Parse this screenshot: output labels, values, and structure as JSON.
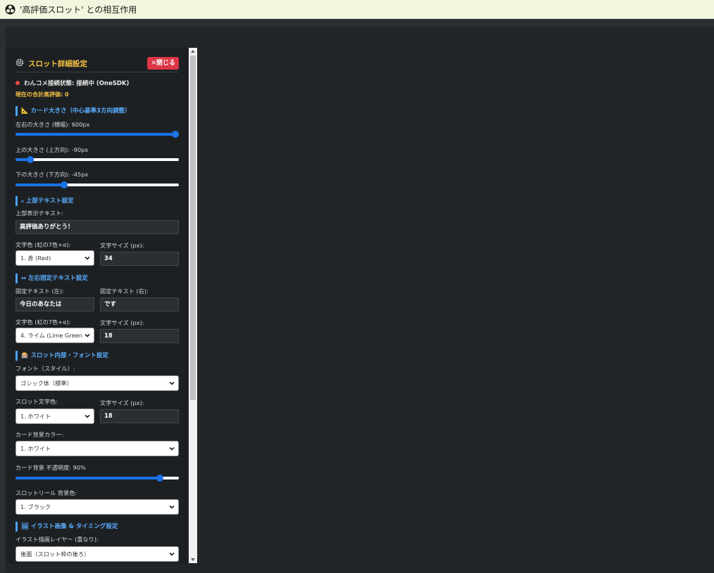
{
  "window": {
    "title": "'高評価スロット' との相互作用"
  },
  "panel": {
    "title": "スロット詳細設定",
    "close_label": "✕閉じる",
    "status_text": "わんコメ接続状態: 接続中 (OneSDK)",
    "total_text": "現在の合計高評価: 0",
    "card_size": {
      "heading": "📐 カード大きさ（中心基準3方向調整）",
      "width_label": "左右の大きさ (横幅): 600px",
      "width_level": 1.0,
      "top_label": "上の大きさ (上方向): -90px",
      "top_level": 0.07,
      "bottom_label": "下の大きさ (下方向): -45px",
      "bottom_level": 0.29
    },
    "top_text": {
      "heading": "ℴ 上部テキスト設定",
      "text_label": "上部表示テキスト:",
      "text_value": "高評価ありがとう！",
      "color_label": "文字色 (虹の7色+α):",
      "color_value": "1. 赤 (Red)",
      "size_label": "文字サイズ (px):",
      "size_value": "34"
    },
    "side_text": {
      "heading": "↔ 左右固定テキスト設定",
      "left_label": "固定テキスト (左):",
      "left_value": "今日のあなたは",
      "right_label": "固定テキスト (右):",
      "right_value": "です",
      "color_label": "文字色 (虹の7色+α):",
      "color_value": "4. ライム (Lime Green",
      "size_label": "文字サイズ (px):",
      "size_value": "18"
    },
    "slot_font": {
      "heading": "🎰 スロット内部・フォント設定",
      "font_label": "フォント（スタイル）:",
      "font_value": "ゴシック体（標準）",
      "slot_color_label": "スロット文字色:",
      "slot_color_value": "1. ホワイト",
      "size_label": "文字サイズ (px):",
      "size_value": "18",
      "bg_color_label": "カード背景カラー:",
      "bg_color_value": "1. ホワイト",
      "opacity_label": "カード背景 不透明度: 90%",
      "opacity_level": 0.9,
      "reel_bg_label": "スロットリール 背景色:",
      "reel_bg_value": "1. ブラック"
    },
    "illustration": {
      "heading": "🖼 イラスト画像 & タイミング設定",
      "layer_label": "イラスト描画レイヤー (重なり):",
      "layer_value": "後面（スロット枠の後ろ）"
    }
  },
  "colors": {
    "accent": "#1a73e8",
    "heading": "#5aaeff",
    "title": "#f6c343",
    "danger": "#dc3545"
  }
}
